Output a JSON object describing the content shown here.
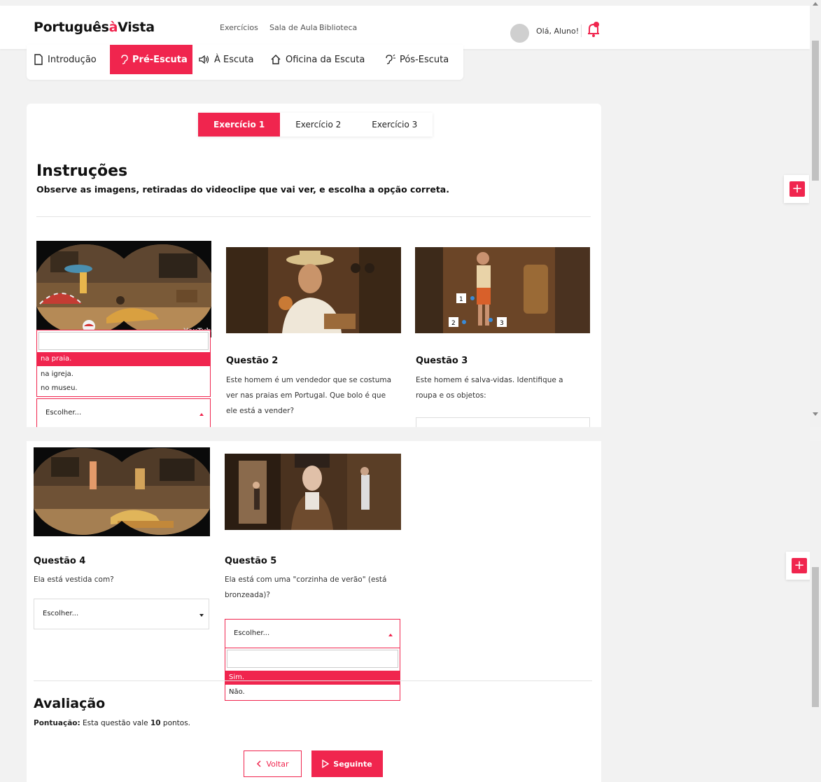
{
  "brand": {
    "logo_pre": "Português",
    "logo_a": "à",
    "logo_post": "Vista"
  },
  "nav": {
    "items": [
      "Exercícios",
      "Sala de Aula",
      "Biblioteca"
    ],
    "active": 0
  },
  "user": {
    "greeting": "Olá, Aluno!"
  },
  "steps": [
    {
      "label": "Introdução",
      "icon": "document-icon"
    },
    {
      "label": "Pré-Escuta",
      "icon": "ear-icon"
    },
    {
      "label": "À Escuta",
      "icon": "speaker-icon"
    },
    {
      "label": "Oficina da Escuta",
      "icon": "house-icon"
    },
    {
      "label": "Pós-Escuta",
      "icon": "ear-sound-icon"
    }
  ],
  "exercise_tabs": [
    "Exercício 1",
    "Exercício 2",
    "Exercício 3"
  ],
  "instructions": {
    "title": "Instruções",
    "text": "Observe as imagens, retiradas do videoclipe que vai ver, e escolha a opção correta."
  },
  "questions": {
    "q1": {
      "options": [
        "na praia.",
        "na igreja.",
        "no museu."
      ],
      "selected": 0,
      "select_value": "Escolher...",
      "watermark": "YouTube"
    },
    "q2": {
      "title": "Questão 2",
      "lines": [
        "Este homem é um vendedor que se costuma",
        "ver nas praias em Portugal. Que bolo é que",
        "ele está a vender?"
      ]
    },
    "q3": {
      "title": "Questão 3",
      "lines": [
        "Este homem é salva-vidas. Identifique a",
        "roupa e os objetos:"
      ],
      "markers": [
        "1",
        "2",
        "3"
      ]
    },
    "q4": {
      "title": "Questão 4",
      "lines": [
        "Ela está vestida com?"
      ],
      "select_value": "Escolher..."
    },
    "q5": {
      "title": "Questão 5",
      "lines": [
        "Ela está com uma \"corzinha de verão\" (está",
        "bronzeada)?"
      ],
      "select_value": "Escolher...",
      "options": [
        "Sim.",
        "Não."
      ],
      "selected": 0
    }
  },
  "evaluation": {
    "title": "Avaliação",
    "score_label": "Pontuação:",
    "score_pre": " Esta questão vale ",
    "points": "10",
    "score_post": " pontos."
  },
  "buttons": {
    "back": "Voltar",
    "next": "Seguinte"
  },
  "colors": {
    "accent": "#f0254e"
  }
}
